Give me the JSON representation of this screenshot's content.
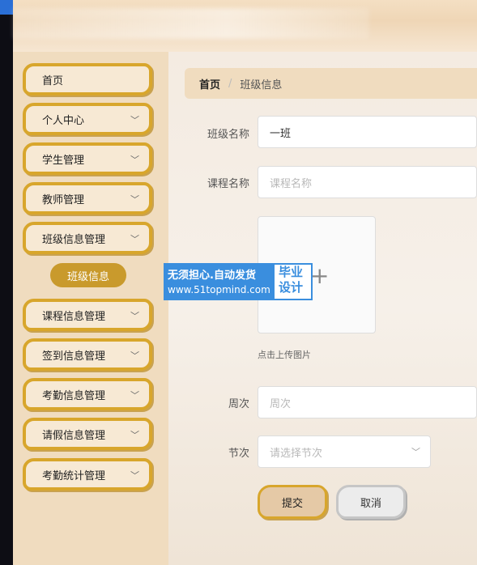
{
  "sidebar": {
    "items": [
      {
        "label": "首页"
      },
      {
        "label": "个人中心"
      },
      {
        "label": "学生管理"
      },
      {
        "label": "教师管理"
      },
      {
        "label": "班级信息管理"
      },
      {
        "label": "课程信息管理"
      },
      {
        "label": "签到信息管理"
      },
      {
        "label": "考勤信息管理"
      },
      {
        "label": "请假信息管理"
      },
      {
        "label": "考勤统计管理"
      }
    ],
    "sub_item": "班级信息"
  },
  "breadcrumb": {
    "home": "首页",
    "separator": "/",
    "current": "班级信息"
  },
  "form": {
    "class_name_label": "班级名称",
    "class_name_value": "一班",
    "course_name_label": "课程名称",
    "course_name_placeholder": "课程名称",
    "upload_hint": "点击上传图片",
    "week_label": "周次",
    "week_placeholder": "周次",
    "section_label": "节次",
    "section_placeholder": "请选择节次",
    "submit_label": "提交",
    "cancel_label": "取消"
  },
  "watermark": {
    "line1": "无须担心.自动发货",
    "line2": "www.51topmind.com",
    "badge_line1": "毕业",
    "badge_line2": "设计"
  },
  "colors": {
    "accent": "#d8a62c",
    "sidebar_bg": "#f0dcbf",
    "active_pill": "#c99a2c"
  }
}
